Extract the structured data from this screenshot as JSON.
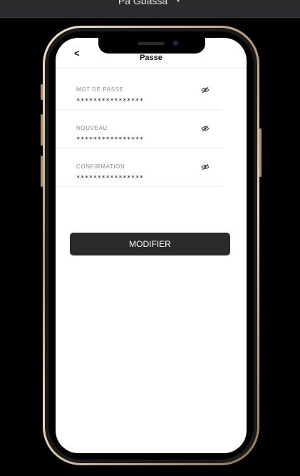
{
  "topbar": {
    "title": "Pa Gbassa"
  },
  "screen": {
    "back_label": "<",
    "title": "Passe",
    "fields": [
      {
        "label": "MOT DE PASSE",
        "value": "****************"
      },
      {
        "label": "NOUVEAU",
        "value": "****************"
      },
      {
        "label": "CONFIRMATION",
        "value": "****************"
      }
    ],
    "button_label": "MODIFIER"
  },
  "icons": {
    "eye": "eye-slash-icon",
    "chevron": "chevron-down-icon",
    "back": "back-arrow-icon"
  },
  "colors": {
    "button": "#2a2a2a",
    "frame": "#c8a982",
    "background": "#000000"
  }
}
